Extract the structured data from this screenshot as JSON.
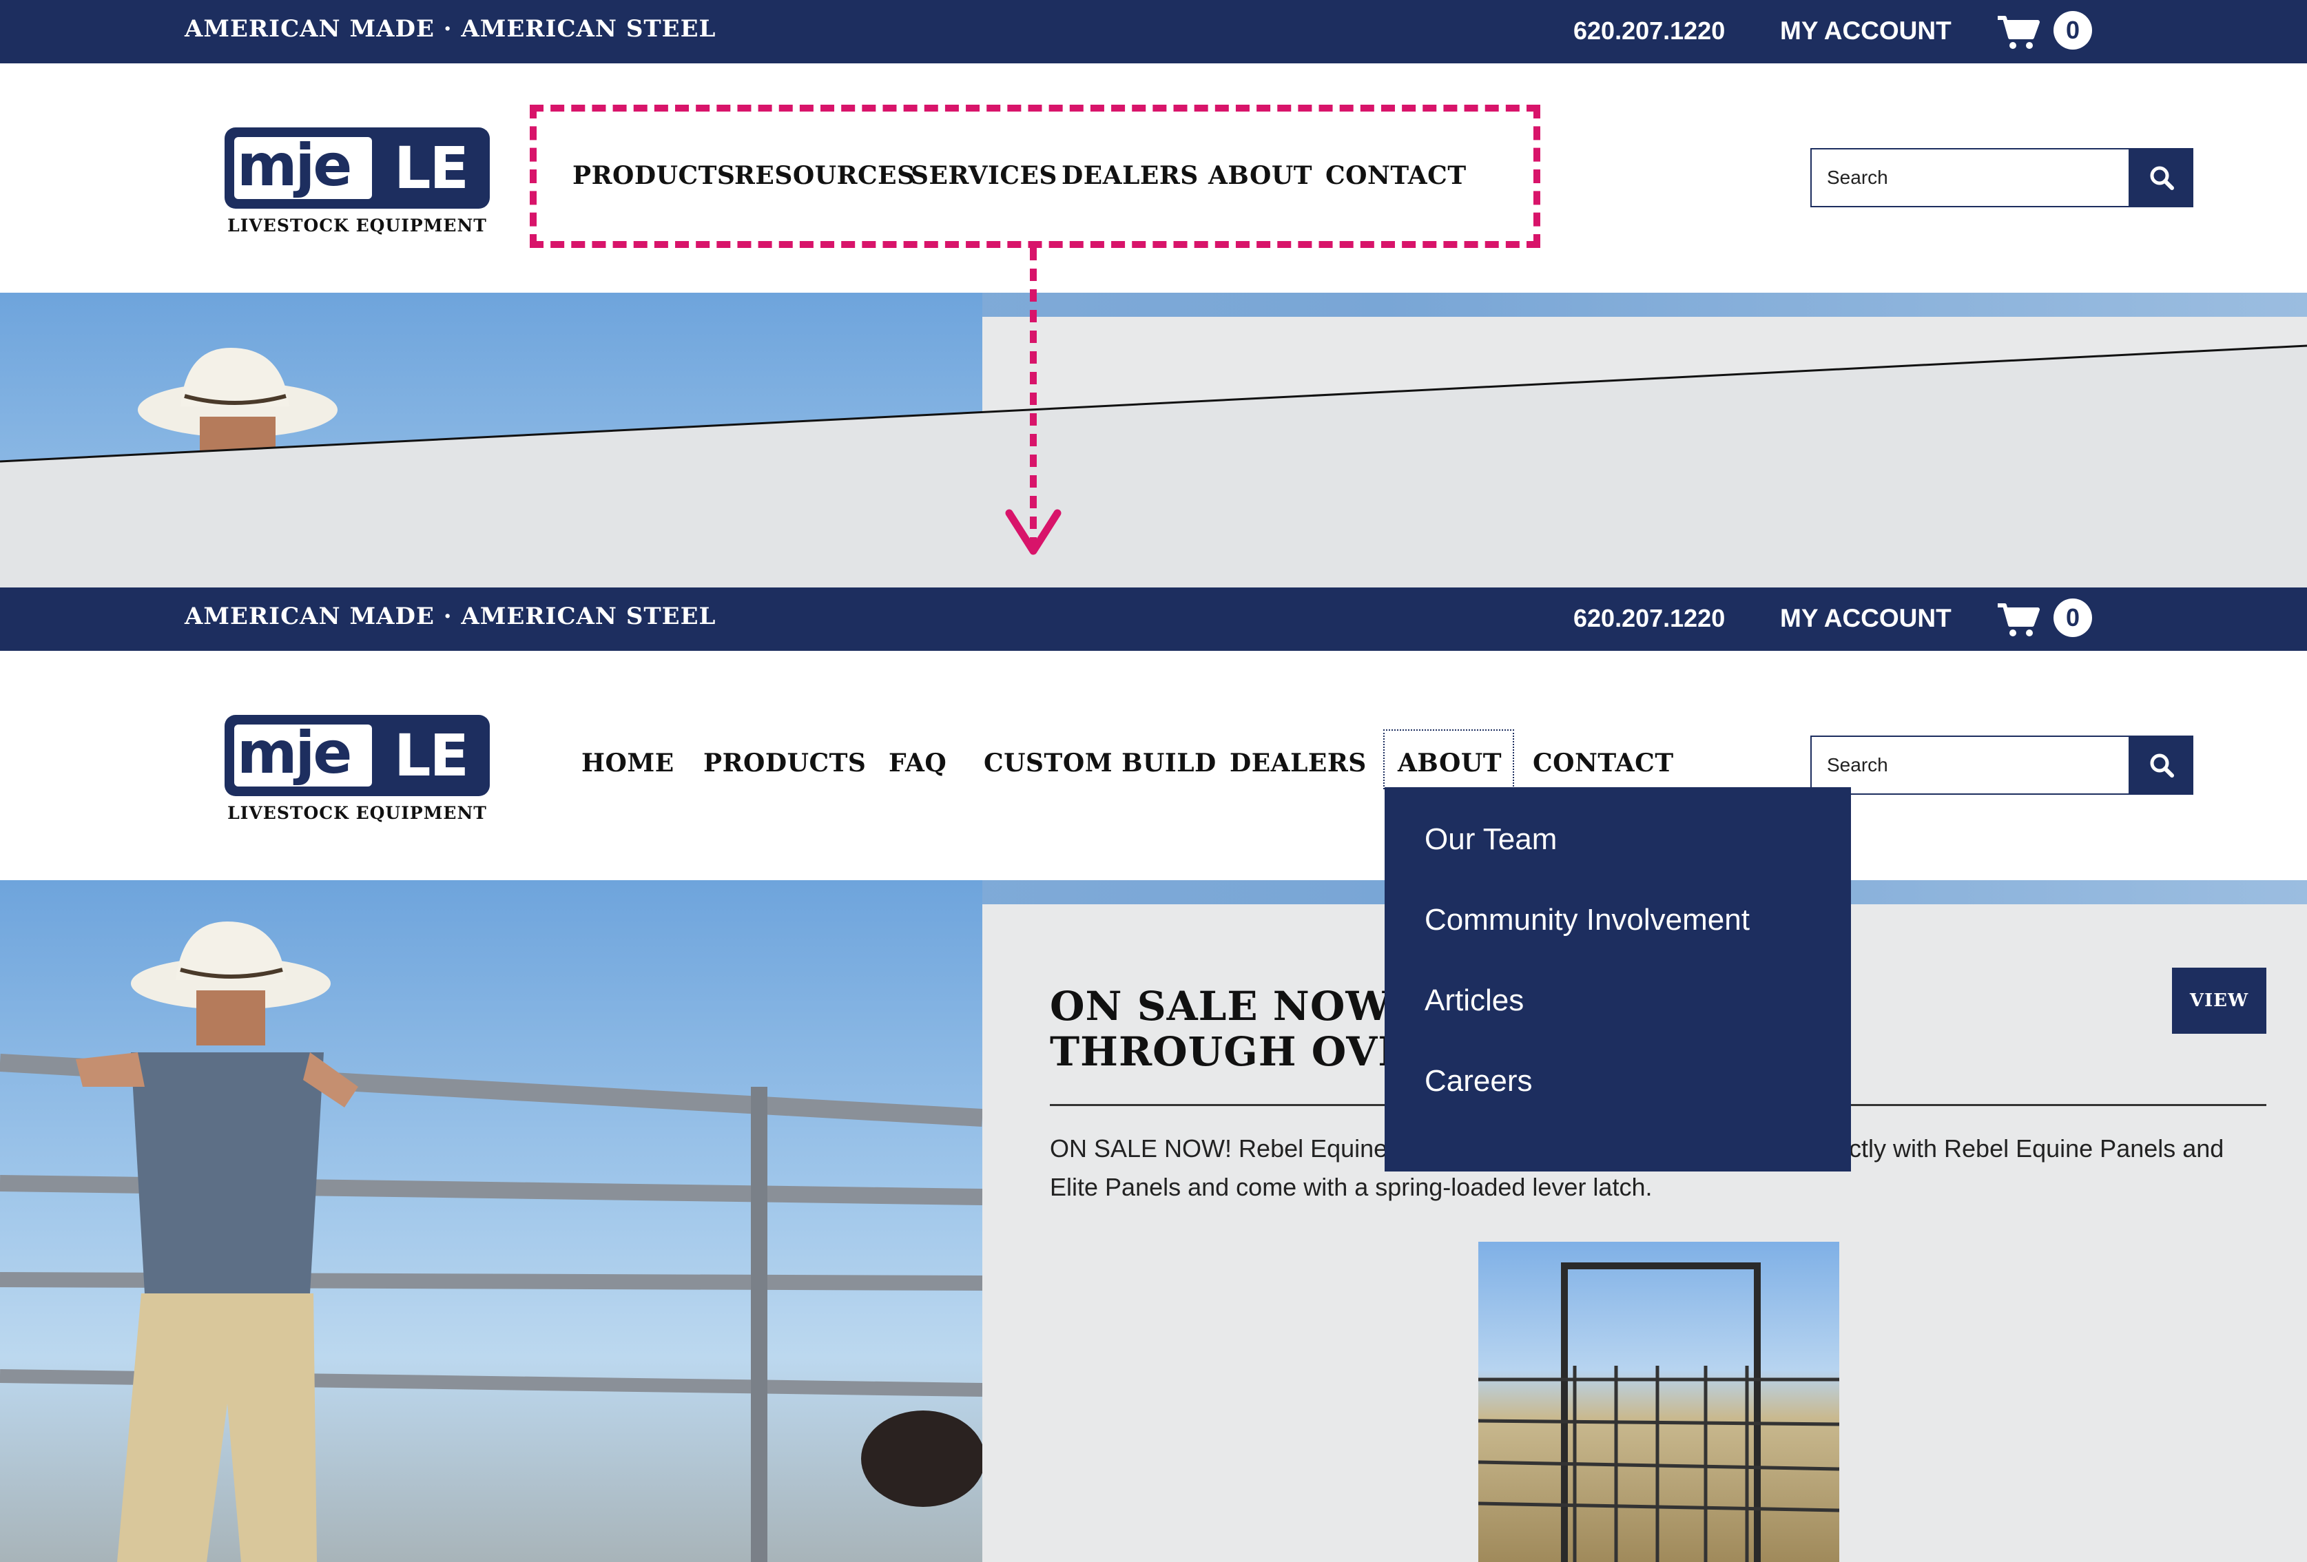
{
  "site": {
    "tagline": "AMERICAN MADE · AMERICAN STEEL",
    "phone": "620.207.1220",
    "account_label": "MY ACCOUNT",
    "cart_count": "0",
    "logo_main": "mje",
    "logo_side": "LE",
    "logo_sub": "LIVESTOCK EQUIPMENT",
    "search_placeholder": "Search",
    "brand_color": "#1d2e5f",
    "annotation_color": "#d8146a"
  },
  "before_nav": [
    "PRODUCTS",
    "RESOURCES",
    "SERVICES",
    "DEALERS",
    "ABOUT",
    "CONTACT"
  ],
  "after_nav": [
    "HOME",
    "PRODUCTS",
    "FAQ",
    "CUSTOM BUILD",
    "DEALERS",
    "ABOUT",
    "CONTACT"
  ],
  "dropdown": {
    "parent": "ABOUT",
    "items": [
      "Our Team",
      "Community Involvement",
      "Articles",
      "Careers"
    ]
  },
  "promo": {
    "title_line1": "ON SALE NOW! I",
    "title_line2": "THROUGH OVER",
    "text_left": "ON SALE NOW! Rebel Equine",
    "text_right": "ctly with Rebel Equine Panels and",
    "text_line2": "Elite Panels and come with a spring-loaded lever latch.",
    "view_label": "VIEW"
  },
  "icons": [
    "cart-icon",
    "search-icon",
    "arrow-down-icon"
  ]
}
